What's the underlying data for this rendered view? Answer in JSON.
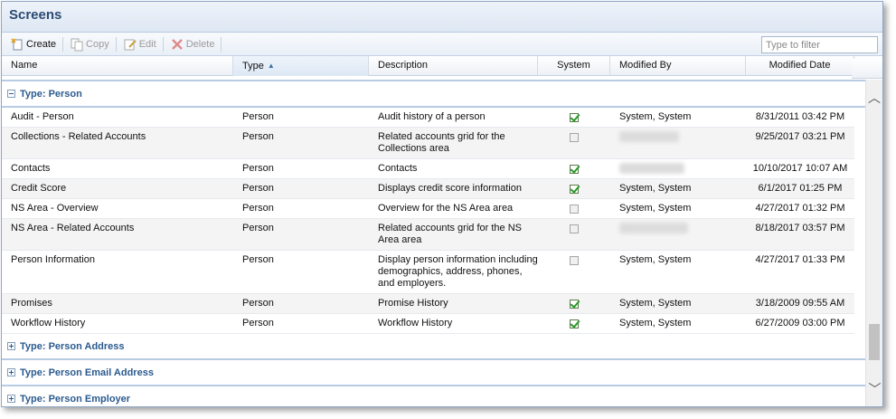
{
  "window": {
    "title": "Screens"
  },
  "toolbar": {
    "create": "Create",
    "copy": "Copy",
    "edit": "Edit",
    "delete": "Delete",
    "filter_placeholder": "Type to filter"
  },
  "columns": {
    "name": "Name",
    "type": "Type",
    "description": "Description",
    "system": "System",
    "modified_by": "Modified By",
    "modified_date": "Modified Date"
  },
  "groups": [
    {
      "label": "Type: Person",
      "expanded": true
    },
    {
      "label": "Type: Person Address",
      "expanded": false
    },
    {
      "label": "Type: Person Email Address",
      "expanded": false
    },
    {
      "label": "Type: Person Employer",
      "expanded": false
    }
  ],
  "rows": [
    {
      "name": "Audit - Person",
      "type": "Person",
      "description": "Audit history of a person",
      "system": true,
      "modified_by": "System, System",
      "modified_date": "8/31/2011 03:42 PM"
    },
    {
      "name": "Collections - Related Accounts",
      "type": "Person",
      "description": "Related accounts grid for the Collections area",
      "system": false,
      "modified_by": "",
      "modified_date": "9/25/2017 03:21 PM"
    },
    {
      "name": "Contacts",
      "type": "Person",
      "description": "Contacts",
      "system": true,
      "modified_by": "",
      "modified_date": "10/10/2017 10:07 AM"
    },
    {
      "name": "Credit Score",
      "type": "Person",
      "description": "Displays credit score information",
      "system": true,
      "modified_by": "System, System",
      "modified_date": "6/1/2017 01:25 PM"
    },
    {
      "name": "NS Area - Overview",
      "type": "Person",
      "description": "Overview for the NS Area area",
      "system": false,
      "modified_by": "System, System",
      "modified_date": "4/27/2017 01:32 PM"
    },
    {
      "name": "NS Area - Related Accounts",
      "type": "Person",
      "description": "Related accounts grid for the NS Area area",
      "system": false,
      "modified_by": "",
      "modified_date": "8/18/2017 03:57 PM"
    },
    {
      "name": "Person Information",
      "type": "Person",
      "description": "Display person information including demographics, address, phones, and employers.",
      "system": false,
      "modified_by": "System, System",
      "modified_date": "4/27/2017 01:33 PM"
    },
    {
      "name": "Promises",
      "type": "Person",
      "description": "Promise History",
      "system": true,
      "modified_by": "System, System",
      "modified_date": "3/18/2009 09:55 AM"
    },
    {
      "name": "Workflow History",
      "type": "Person",
      "description": "Workflow History",
      "system": true,
      "modified_by": "System, System",
      "modified_date": "6/27/2009 03:00 PM"
    }
  ],
  "colors": {
    "accent": "#2b5a8f",
    "title": "#2b4a73",
    "check": "#2a9a2a"
  }
}
